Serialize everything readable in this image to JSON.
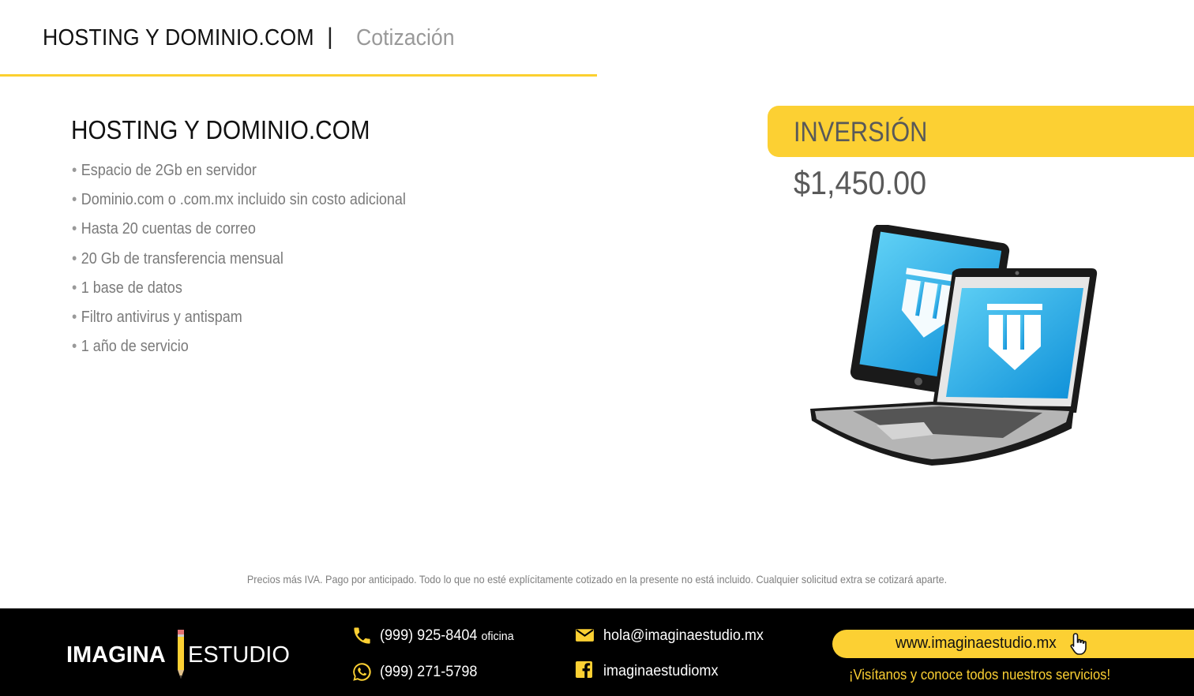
{
  "header": {
    "title": "HOSTING Y DOMINIO.COM",
    "separator": "|",
    "subtitle": "Cotización"
  },
  "product": {
    "title": "HOSTING Y DOMINIO.COM",
    "features": [
      "Espacio de 2Gb en servidor",
      "Dominio.com o  .com.mx incluido sin costo adicional",
      "Hasta 20 cuentas de correo",
      "20 Gb de transferencia mensual",
      "1 base de datos",
      "Filtro antivirus y antispam",
      "1 año de servicio"
    ]
  },
  "investment": {
    "label": "INVERSIÓN",
    "price": "$1,450.00"
  },
  "disclaimer": "Precios más IVA.  Pago por anticipado.  Todo lo que no esté explícitamente cotizado en la presente no está incluido. Cualquier solicitud extra se cotizará aparte.",
  "footer": {
    "logo_left": "IMAGINA",
    "logo_right": "ESTUDIO",
    "phone_office": "(999) 925-8404",
    "phone_office_note": "oficina",
    "whatsapp": "(999) 271-5798",
    "email": "hola@imaginaestudio.mx",
    "facebook": "imaginaestudiomx",
    "website": "www.imaginaestudio.mx",
    "tagline": "¡Visítanos y conoce todos nuestros servicios!"
  },
  "icons": {
    "phone": "phone-icon",
    "whatsapp": "whatsapp-icon",
    "email": "envelope-icon",
    "facebook": "facebook-icon",
    "hand": "pointer-hand-icon",
    "pencil": "pencil-icon",
    "devices": "tablet-laptop-illustration"
  },
  "colors": {
    "accent": "#fcd033",
    "footer_bg": "#000000",
    "text_gray": "#7a7a7a",
    "screen_blue": "#1ea7e6"
  }
}
